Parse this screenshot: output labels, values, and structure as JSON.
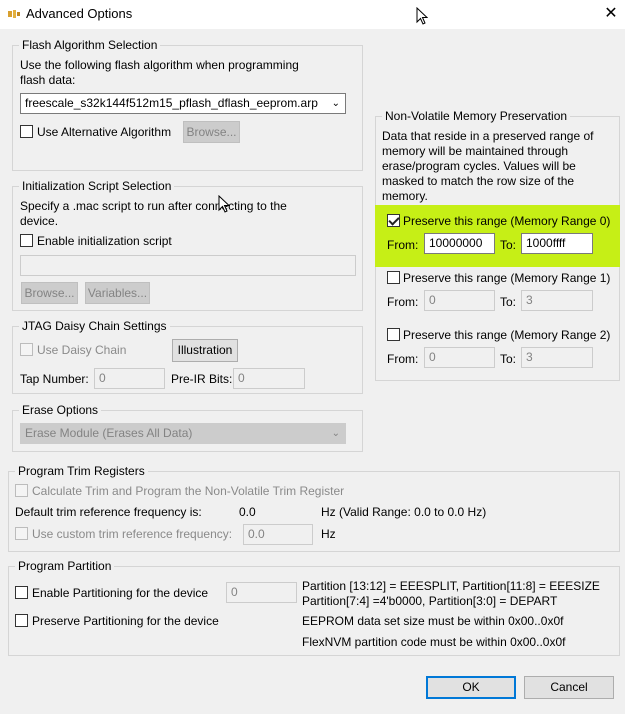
{
  "window": {
    "title": "Advanced Options",
    "close_glyph": "✕"
  },
  "icons": {
    "app": "app-icon",
    "close": "close-icon",
    "cursor": "mouse-cursor-icon"
  },
  "flash": {
    "legend": "Flash Algorithm Selection",
    "desc_line1": "Use the following flash algorithm when programming",
    "desc_line2": "flash data:",
    "selected": "freescale_s32k144f512m15_pflash_dflash_eeprom.arp",
    "alt_label": "Use Alternative Algorithm",
    "browse": "Browse..."
  },
  "init": {
    "legend": "Initialization Script Selection",
    "desc_line1": "Specify a .mac script to run after connecting to the",
    "desc_line2": "device.",
    "enable_label": "Enable initialization script",
    "path_value": "",
    "browse": "Browse...",
    "variables": "Variables..."
  },
  "jtag": {
    "legend": "JTAG Daisy Chain Settings",
    "use_label": "Use Daisy Chain",
    "illustration": "Illustration",
    "tap_label": "Tap Number:",
    "tap_value": "0",
    "preir_label": "Pre-IR Bits:",
    "preir_value": "0"
  },
  "erase": {
    "legend": "Erase Options",
    "selected": "Erase Module (Erases All Data)"
  },
  "nvm": {
    "legend": "Non-Volatile Memory Preservation",
    "desc": [
      "Data that reside in a preserved range of",
      "memory will be maintained through",
      "erase/program cycles. Values will be",
      "masked to match the row size of the",
      "memory."
    ],
    "from_label": "From:",
    "to_label": "To:",
    "ranges": [
      {
        "label": "Preserve this range (Memory Range 0)",
        "checked": true,
        "from": "10000000",
        "to": "1000ffff"
      },
      {
        "label": "Preserve this range (Memory Range 1)",
        "checked": false,
        "from": "0",
        "to": "3"
      },
      {
        "label": "Preserve this range (Memory Range 2)",
        "checked": false,
        "from": "0",
        "to": "3"
      }
    ],
    "highlight_color": "#c6ef16"
  },
  "trim": {
    "legend": "Program Trim Registers",
    "calc_label": "Calculate Trim and Program the Non-Volatile Trim Register",
    "default_label": "Default trim reference frequency is:",
    "default_value": "0.0",
    "default_unit": "Hz (Valid Range: 0.0 to 0.0 Hz)",
    "custom_label": "Use custom trim reference frequency:",
    "custom_value": "0.0",
    "custom_unit": "Hz"
  },
  "partition": {
    "legend": "Program Partition",
    "enable_label": "Enable Partitioning for the device",
    "enable_value": "0",
    "preserve_label": "Preserve Partitioning for the device",
    "info_line1": "Partition [13:12] = EEESPLIT, Partition[11:8] = EEESIZE",
    "info_line2": "Partition[7:4] =4'b0000, Partition[3:0] = DEPART",
    "eeprom_note": "EEPROM data set size must be within 0x00..0x0f",
    "flexnvm_note": "FlexNVM partition code must be within 0x00..0x0f"
  },
  "footer": {
    "ok": "OK",
    "cancel": "Cancel"
  },
  "colors": {
    "accent": "#0078d7"
  }
}
